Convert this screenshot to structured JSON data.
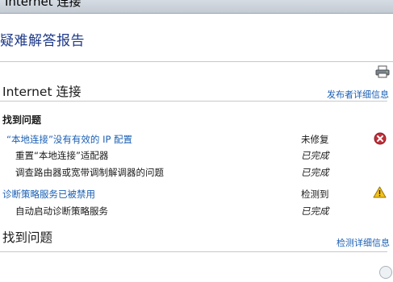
{
  "window": {
    "title": "Internet 连接"
  },
  "report": {
    "title": "疑难解答报告"
  },
  "section1": {
    "title": "Internet 连接",
    "details_link": "发布者详细信息",
    "subheading": "找到问题",
    "rows": [
      {
        "text": "“本地连接”没有有效的 IP 配置",
        "status": "未修复",
        "status_icon": "error-icon"
      },
      {
        "text": "重置“本地连接”适配器",
        "status": "已完成"
      },
      {
        "text": "调查路由器或宽带调制解调器的问题",
        "status": "已完成"
      },
      {
        "text": "诊断策略服务已被禁用",
        "status": "检测到",
        "status_icon": "warning-icon"
      },
      {
        "text": "自动启动诊断策略服务",
        "status": "已完成"
      }
    ]
  },
  "section2": {
    "title": "找到问题",
    "details_link": "检测详细信息"
  },
  "colors": {
    "link": "#1a5fb4",
    "title": "#1e3a8a",
    "error": "#c0303a",
    "warning": "#f2c21b"
  }
}
